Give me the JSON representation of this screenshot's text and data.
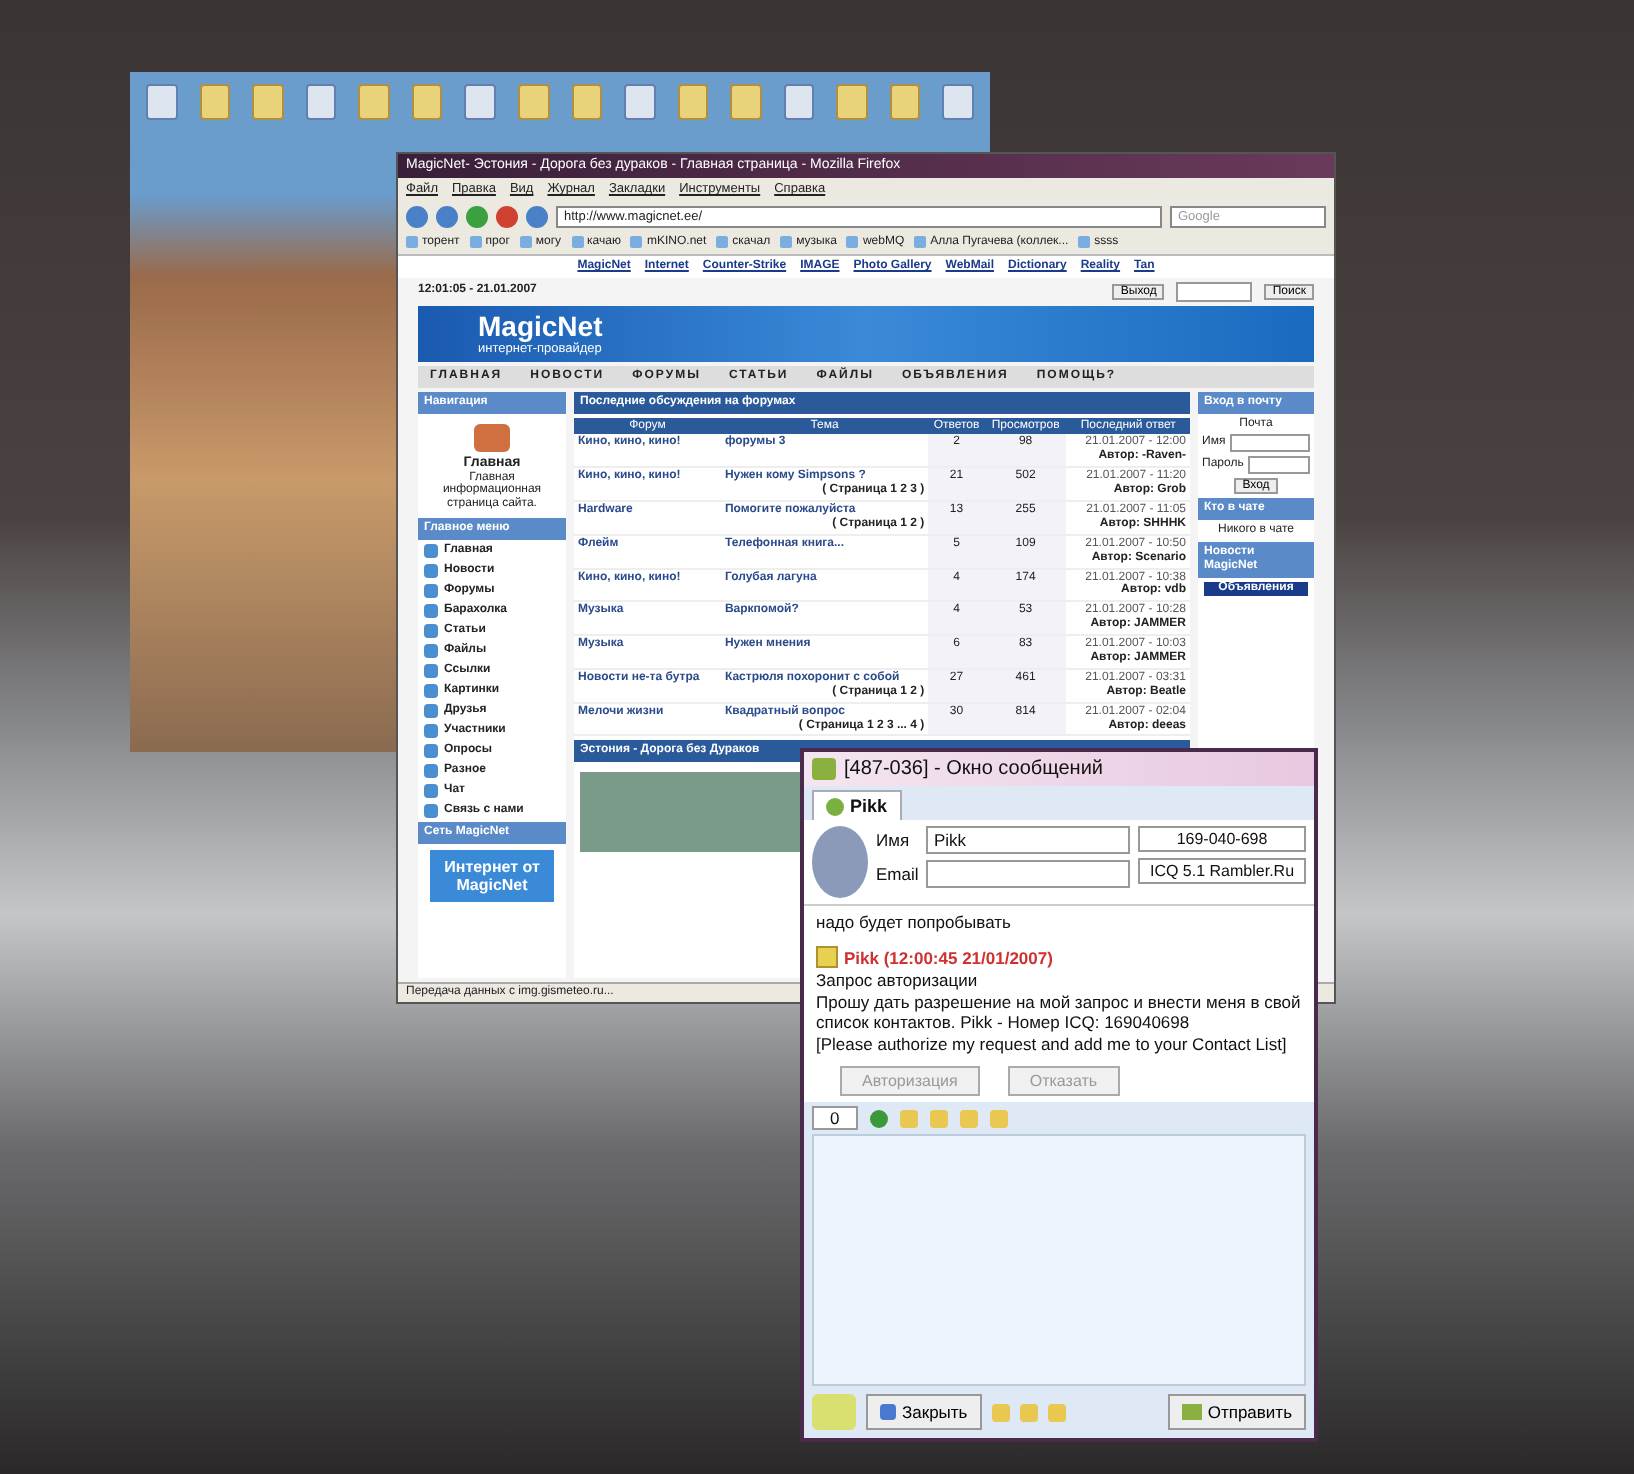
{
  "browser": {
    "title": "MagicNet- Эстония - Дорога без дураков - Главная страница - Mozilla Firefox",
    "menu": [
      "Файл",
      "Правка",
      "Вид",
      "Журнал",
      "Закладки",
      "Инструменты",
      "Справка"
    ],
    "url": "http://www.magicnet.ee/",
    "search": {
      "placeholder": "Google"
    },
    "bookmarks": [
      "торент",
      "прог",
      "могу",
      "качаю",
      "mKINO.net",
      "скачал",
      "музыка",
      "webMQ",
      "Алла Пугачева (коллек...",
      "ssss"
    ],
    "links": [
      "MagicNet",
      "Internet",
      "Counter-Strike",
      "IMAGE",
      "Photo Gallery",
      "WebMail",
      "Dictionary",
      "Reality",
      "Tan"
    ],
    "date": "12:01:05 - 21.01.2007",
    "logout": "Выход",
    "search_button": "Поиск",
    "banner": {
      "logo": "MagicNet",
      "tagline": "интернет-провайдер"
    },
    "nav": [
      "ГЛАВНАЯ",
      "НОВОСТИ",
      "ФОРУМЫ",
      "СТАТЬИ",
      "ФАЙЛЫ",
      "ОБЪЯВЛЕНИЯ",
      "ПОМОЩЬ?"
    ],
    "left": {
      "nav_header": "Навигация",
      "home_title": "Главная",
      "home_desc": "Главная информационная страница сайта.",
      "menu_header": "Главное меню",
      "menu": [
        "Главная",
        "Новости",
        "Форумы",
        "Барахолка",
        "Статьи",
        "Файлы",
        "Ссылки",
        "Картинки",
        "Друзья",
        "Участники",
        "Опросы",
        "Разное",
        "Чат",
        "Связь с нами"
      ],
      "network_header": "Сеть MagicNet",
      "ad": "Интернет от MagicNet"
    },
    "forum": {
      "header": "Последние обсуждения на форумах",
      "columns": [
        "Форум",
        "Тема",
        "Ответов",
        "Просмотров",
        "Последний ответ"
      ],
      "rows": [
        {
          "forum": "Кино, кино, кино!",
          "topic": "форумы 3",
          "replies": "2",
          "views": "98",
          "date": "21.01.2007 - 12:00",
          "author": "Автор: -Raven-"
        },
        {
          "forum": "Кино, кино, кино!",
          "topic": "Нужен кому Simpsons ?",
          "pages": "( Страница 1 2 3 )",
          "replies": "21",
          "views": "502",
          "date": "21.01.2007 - 11:20",
          "author": "Автор: Grob"
        },
        {
          "forum": "Hardware",
          "topic": "Помогите пожалуйста",
          "pages": "( Страница 1 2 )",
          "replies": "13",
          "views": "255",
          "date": "21.01.2007 - 11:05",
          "author": "Автор: SHHHK"
        },
        {
          "forum": "Флейм",
          "topic": "Телефонная книга...",
          "replies": "5",
          "views": "109",
          "date": "21.01.2007 - 10:50",
          "author": "Автор: Scenario"
        },
        {
          "forum": "Кино, кино, кино!",
          "topic": "Голубая лагуна",
          "replies": "4",
          "views": "174",
          "date": "21.01.2007 - 10:38",
          "author": "Автор: vdb"
        },
        {
          "forum": "Музыка",
          "topic": "Варкпомой?",
          "replies": "4",
          "views": "53",
          "date": "21.01.2007 - 10:28",
          "author": "Автор: JAMMER"
        },
        {
          "forum": "Музыка",
          "topic": "Нужен мнения",
          "replies": "6",
          "views": "83",
          "date": "21.01.2007 - 10:03",
          "author": "Автор: JAMMER"
        },
        {
          "forum": "Новости не-та бутра",
          "topic": "Кастрюля похоронит с собой",
          "pages": "( Страница 1 2 )",
          "replies": "27",
          "views": "461",
          "date": "21.01.2007 - 03:31",
          "author": "Автор: Beatle"
        },
        {
          "forum": "Мелочи жизни",
          "topic": "Квадратный вопрос",
          "pages": "( Страница 1 2 3 ... 4 )",
          "replies": "30",
          "views": "814",
          "date": "21.01.2007 - 02:04",
          "author": "Автор: deeas"
        }
      ]
    },
    "news": {
      "header": "Эстония - Дорога без Дураков"
    },
    "right": {
      "mail_header": "Вход в почту",
      "mail_title": "Почта",
      "name_label": "Имя",
      "password_label": "Пароль",
      "login_button": "Вход",
      "chat_header": "Кто в чате",
      "chat_text": "Никого в чате",
      "news_header": "Новости MagicNet",
      "news_tab": "Объявления"
    },
    "status_bar": "Передача данных с img.gismeteo.ru..."
  },
  "icq": {
    "title": "[487-036] - Окно сообщений",
    "tabs": [
      {
        "label": "Pikk",
        "selected": true
      }
    ],
    "name_label": "Имя",
    "name_value": "Pikk",
    "email_label": "Email",
    "uin": "169-040-698",
    "client": "ICQ 5.1 Rambler.Ru",
    "messages": [
      {
        "kind": "text",
        "text": "надо будет попробывать"
      },
      {
        "kind": "header",
        "text": "Pikk (12:00:45 21/01/2007)"
      },
      {
        "kind": "text",
        "text": "Запрос авторизации"
      },
      {
        "kind": "text",
        "text": "Прошу дать разрешение на мой запрос и внести меня в свой список контактов. Pikk - Номер ICQ: 169040698"
      },
      {
        "kind": "text",
        "text": "[Please authorize my request and add me to your Contact List]"
      }
    ],
    "auth_buttons": [
      {
        "label": "Авторизация",
        "disabled": true
      },
      {
        "label": "Отказать",
        "disabled": true
      }
    ],
    "counter": "0",
    "close": "Закрыть",
    "send": "Отправить"
  }
}
